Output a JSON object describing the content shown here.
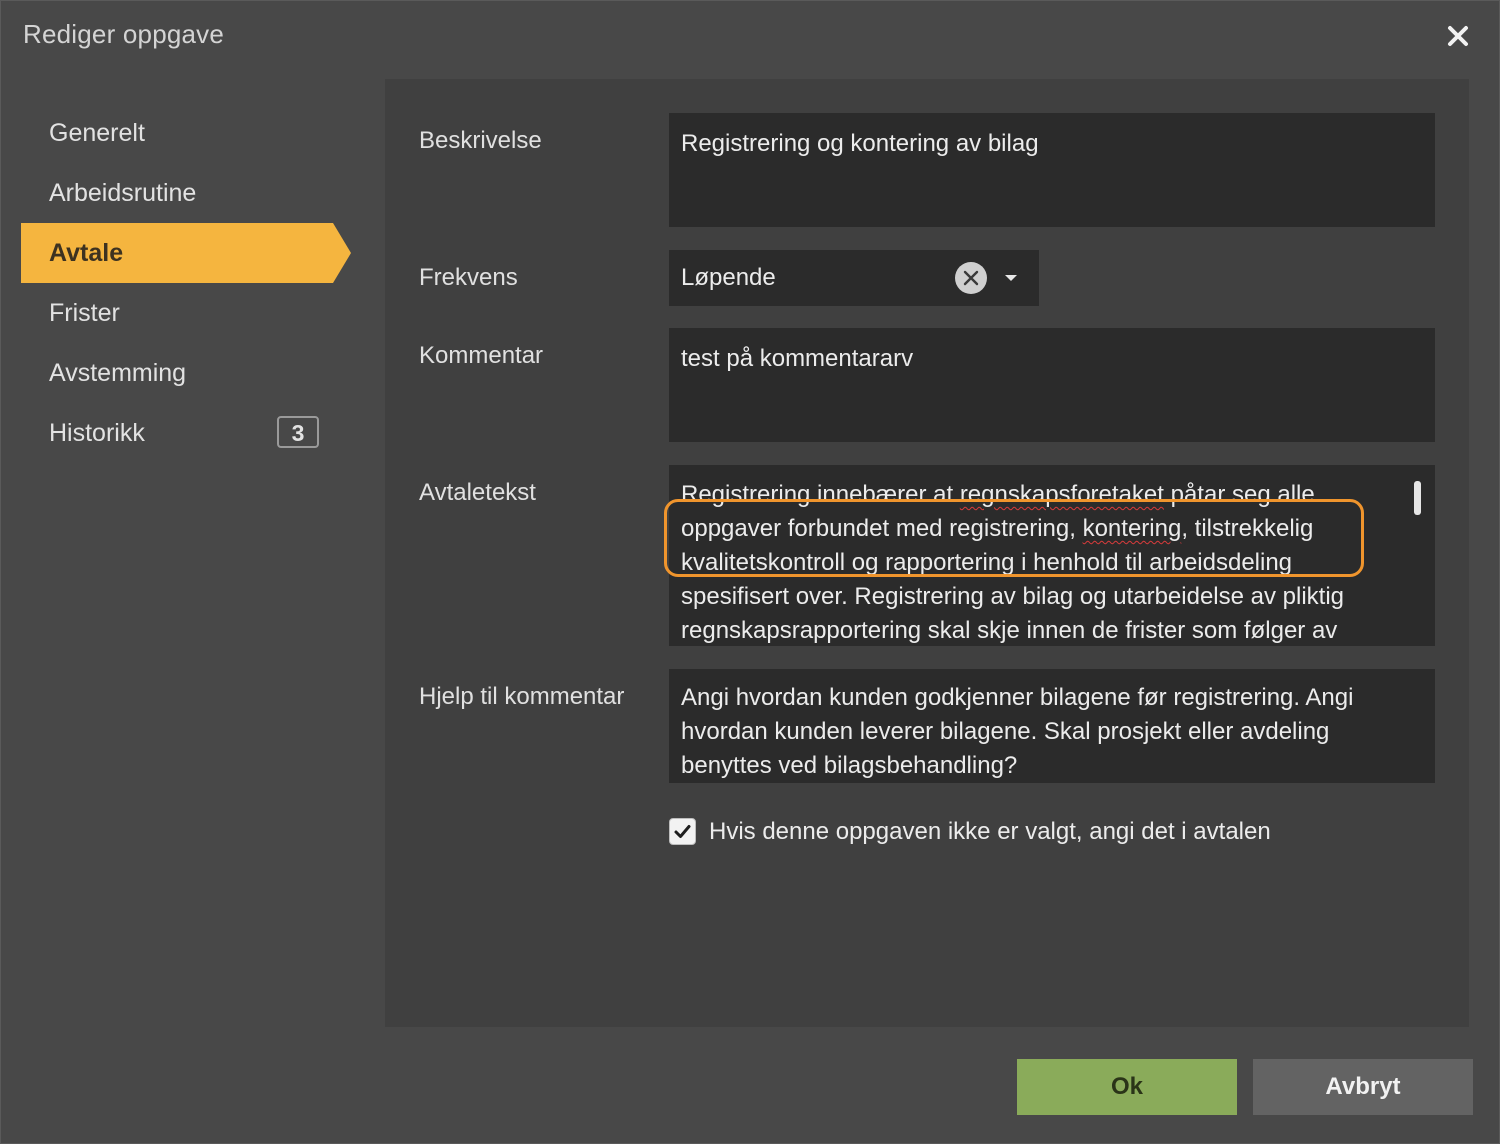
{
  "dialog": {
    "title": "Rediger oppgave",
    "close_icon": "close-icon"
  },
  "sidebar": {
    "items": [
      {
        "label": "Generelt"
      },
      {
        "label": "Arbeidsrutine"
      },
      {
        "label": "Avtale",
        "active": true
      },
      {
        "label": "Frister"
      },
      {
        "label": "Avstemming"
      },
      {
        "label": "Historikk",
        "badge": "3"
      }
    ]
  },
  "form": {
    "beskrivelse": {
      "label": "Beskrivelse",
      "value": "Registrering og kontering av bilag"
    },
    "frekvens": {
      "label": "Frekvens",
      "value": "Løpende"
    },
    "kommentar": {
      "label": "Kommentar",
      "value": "test på kommentararv"
    },
    "avtaletekst": {
      "label": "Avtaletekst",
      "part1": "Registrering innebærer at ",
      "spell1": "regnskapsforetaket",
      "part2": " påtar seg alle oppgaver forbundet med registrering, ",
      "spell2": "kontering",
      "part3": ", tilstrekkelig kvalitetskontroll og rapportering i henhold til arbeidsdeling spesifisert over.   Registrering av bilag og utarbeidelse av pliktig regnskapsrapportering skal skje innen de frister som følger av"
    },
    "hjelp": {
      "label": "Hjelp til kommentar",
      "value": "Angi hvordan kunden godkjenner bilagene før registrering.  Angi hvordan kunden leverer bilagene.  Skal prosjekt eller avdeling benyttes ved bilagsbehandling?"
    },
    "checkbox": {
      "checked": true,
      "label": "Hvis denne oppgaven ikke er valgt, angi det i avtalen"
    }
  },
  "footer": {
    "ok_label": "Ok",
    "cancel_label": "Avbryt"
  },
  "colors": {
    "accent": "#f5b53f",
    "ok": "#8aab5a",
    "highlight": "#f0952d"
  }
}
